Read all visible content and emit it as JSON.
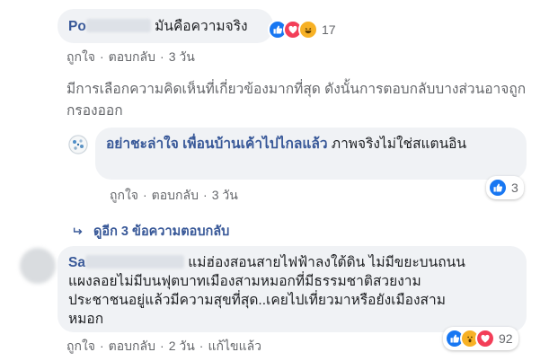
{
  "comment1": {
    "author_visible": "Po",
    "text": "มันคือความจริง",
    "reaction_count": "17",
    "reaction_icons": [
      "like-icon",
      "love-icon",
      "haha-icon"
    ],
    "actions": {
      "like": "ถูกใจ",
      "reply": "ตอบกลับ",
      "time": "3 วัน"
    }
  },
  "filter_notice": "มีการเลือกความคิดเห็นที่เกี่ยวข้องมากที่สุด ดังนั้นการตอบกลับบางส่วนอาจถูกกรองออก",
  "reply1": {
    "author": "อย่าชะล่าใจ เพื่อนบ้านเค้าไปไกลแล้ว",
    "text": "ภาพจริงไม่ใช่สแตนอิน",
    "reaction_count": "3",
    "reaction_icons": [
      "like-icon"
    ],
    "actions": {
      "like": "ถูกใจ",
      "reply": "ตอบกลับ",
      "time": "3 วัน"
    }
  },
  "more_replies": "ดูอีก 3 ข้อความตอบกลับ",
  "comment2": {
    "author_visible": "Sa",
    "text_line1": "แม่ฮ่องสอนสายไฟฟ้าลงใต้ดิน ไม่มีขยะบนถนน",
    "text_line2": "แผงลอยไม่มีบนฟุตบาทเมืองสามหมอกที่มีธรรมชาติสวยงาม",
    "text_line3": "ประชาชนอยู่แล้วมีความสุขที่สุด..เคยไปเที่ยวมาหรือยังเมืองสาม",
    "text_line4": "หมอก",
    "reaction_count": "92",
    "reaction_icons": [
      "like-icon",
      "wow-icon",
      "love-icon"
    ],
    "actions": {
      "like": "ถูกใจ",
      "reply": "ตอบกลับ",
      "time": "2 วัน",
      "edited": "แก้ไขแล้ว"
    }
  },
  "colors": {
    "like": "#1877f2",
    "love": "#f33e58",
    "haha": "#f7b125",
    "wow": "#f7b125",
    "name": "#385898",
    "meta": "#65676b",
    "bubble": "#f0f2f5"
  }
}
